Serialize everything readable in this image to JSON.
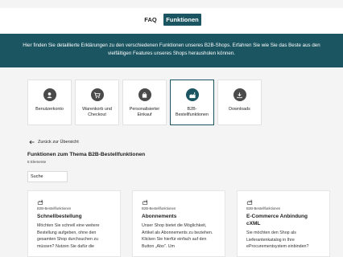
{
  "tabs": [
    {
      "label": "FAQ"
    },
    {
      "label": "Funktionen"
    }
  ],
  "banner": {
    "text": "Hier finden Sie detaillierte Erklärungen zu den verschiedenen Funktionen unseres B2B-Shops. Erfahren Sie wie Sie das Beste aus den vielfältigen Features unseres Shops herausholen können."
  },
  "categories": [
    {
      "label": "Benutzerkonto",
      "icon": "user-icon"
    },
    {
      "label": "Warenkorb und Checkout",
      "icon": "cart-icon"
    },
    {
      "label": "Personalisierter Einkauf",
      "icon": "bag-icon"
    },
    {
      "label": "B2B-Bestellfunktionen",
      "icon": "factory-icon",
      "active": true
    },
    {
      "label": "Downloads",
      "icon": "download-icon"
    }
  ],
  "back_link": "Zurück zur Übersicht",
  "section": {
    "title": "Funktionen zum Thema B2B-Bestellfunktionen",
    "count": "5 Elemente"
  },
  "search": {
    "value": "Suche"
  },
  "cards": [
    {
      "category": "B2B-Bestellfunktionen",
      "title": "Schnellbestellung",
      "text": "Möchten Sie schnell eine weitere Bestellung aufgeben, ohne den gesamten Shop durchsuchen zu müssen? Nutzen Sie dafür die"
    },
    {
      "category": "B2B-Bestellfunktionen",
      "title": "Abonnements",
      "text": "Unser Shop bietet die Möglichkeit, Artikel als Abonnements zu beziehen. Klicken Sie hierfür einfach auf den Button „Abo\". Um"
    },
    {
      "category": "B2B-Bestellfunktionen",
      "title": "E-Commerce Anbindung cXML",
      "text": "Sie möchten den Shop als Lieferantenkatalog in Ihre eProcurementsystem einbinden?"
    }
  ],
  "colors": {
    "accent": "#1a5561",
    "background": "#f4f4f4"
  }
}
